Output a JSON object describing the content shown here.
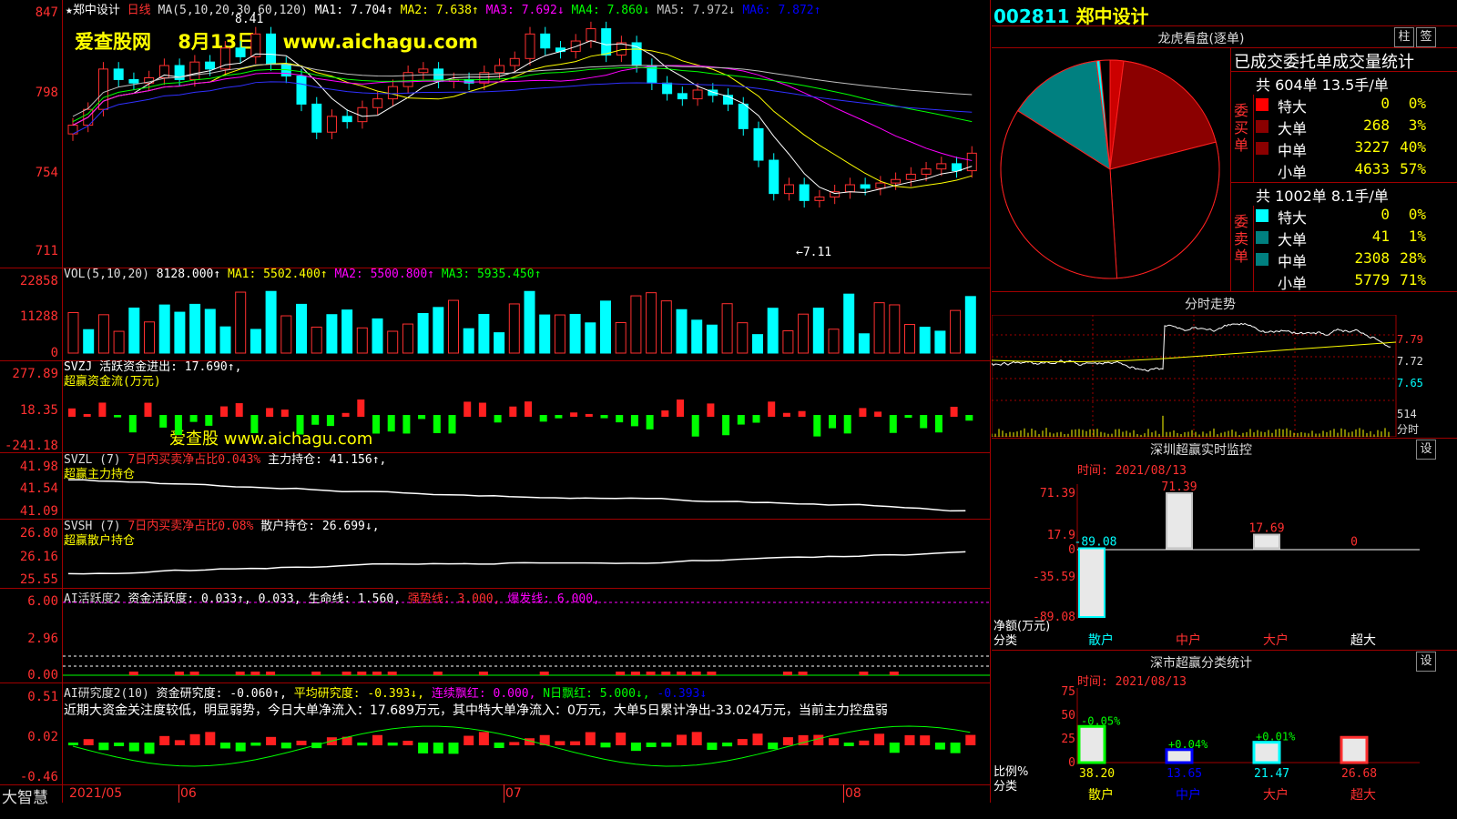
{
  "stock": {
    "code": "002811",
    "name": "郑中设计",
    "period": "日线"
  },
  "watermark": {
    "site": "爱查股网",
    "date": "8月13日",
    "url": "www.aichagu.com",
    "mid": "爱查股 www.aichagu.com"
  },
  "price_panel": {
    "header": {
      "ma_def": "MA(5,10,20,30,60,120)",
      "ma1": "MA1: 7.704↑",
      "ma2": "MA2: 7.638↑",
      "ma3": "MA3: 7.692↓",
      "ma4": "MA4: 7.860↓",
      "ma5": "MA5: 7.972↓",
      "ma6": "MA6: 7.872↑"
    },
    "y_labels": [
      "847",
      "798",
      "754",
      "711"
    ],
    "high_label": "8.41",
    "low_label": "←7.11"
  },
  "vol_panel": {
    "header": {
      "name": "VOL(5,10,20)",
      "value": "8128.000↑",
      "ma1": "MA1: 5502.400↑",
      "ma2": "MA2: 5500.800↑",
      "ma3": "MA3: 5935.450↑"
    },
    "y_labels": [
      "22858",
      "11288",
      "0"
    ]
  },
  "svzj_panel": {
    "header": {
      "line1": "SVZJ  活跃资金进出: 17.690↑,",
      "line2": "超赢资金流(万元)"
    },
    "y_labels": [
      "277.89",
      "18.35",
      "-241.18"
    ]
  },
  "svzl_panel": {
    "header": {
      "name": "SVZL (7)",
      "ratio": "7日内买卖净占比0.043%",
      "hold": "主力持仓: 41.156↑,",
      "line2": "超赢主力持仓"
    },
    "y_labels": [
      "41.98",
      "41.54",
      "41.09"
    ]
  },
  "svsh_panel": {
    "header": {
      "name": "SVSH (7)",
      "ratio": "7日内买卖净占比0.08%",
      "hold": "散户持仓: 26.699↓,",
      "line2": "超赢散户持仓"
    },
    "y_labels": [
      "26.80",
      "26.16",
      "25.55"
    ]
  },
  "ai_active_panel": {
    "header": {
      "name": "AI活跃度2",
      "active": "资金活跃度: 0.033↑, 0.033,",
      "life": "生命线: 1.560,",
      "strong": "强势线: 3.000,",
      "burst": "爆发线: 6.000,"
    },
    "y_labels": [
      "6.00",
      "2.96",
      "0.00"
    ]
  },
  "ai_research_panel": {
    "header": {
      "name": "AI研究度2(10)",
      "research": "资金研究度: -0.060↑,",
      "avg": "平均研究度: -0.393↓,",
      "red": "连续飘红: 0.000,",
      "nred": "N日飘红: 5.000↓,",
      "val": "-0.393↓"
    },
    "comment": "近期大资金关注度较低，明显弱势，今日大单净流入：17.689万元，其中特大单净流入：0万元，大单5日累计净出-33.024万元，当前主力控盘弱",
    "y_labels": [
      "0.51",
      "0.02",
      "-0.46"
    ]
  },
  "x_axis": {
    "labels": [
      "2021/05",
      "06",
      "07",
      "08"
    ],
    "brand": "大智慧"
  },
  "right": {
    "lhb_title": "龙虎看盘(逐单)",
    "btn_zhu": "柱",
    "btn_gear": "签",
    "stats_title": "已成交委托单成交量统计",
    "buy": {
      "summary": "共 604单 13.5手/单",
      "side_label": "委买单",
      "rows": [
        {
          "name": "特大",
          "count": "0",
          "pct": "0%"
        },
        {
          "name": "大单",
          "count": "268",
          "pct": "3%"
        },
        {
          "name": "中单",
          "count": "3227",
          "pct": "40%"
        },
        {
          "name": "小单",
          "count": "4633",
          "pct": "57%"
        }
      ]
    },
    "sell": {
      "summary": "共 1002单 8.1手/单",
      "side_label": "委卖单",
      "rows": [
        {
          "name": "特大",
          "count": "0",
          "pct": "0%"
        },
        {
          "name": "大单",
          "count": "41",
          "pct": "1%"
        },
        {
          "name": "中单",
          "count": "2308",
          "pct": "28%"
        },
        {
          "name": "小单",
          "count": "5779",
          "pct": "71%"
        }
      ]
    },
    "pie": {
      "slices": [
        {
          "label": "buy-large",
          "pct": 2
        },
        {
          "label": "buy-mid",
          "pct": 19
        },
        {
          "label": "buy-small",
          "pct": 28
        },
        {
          "label": "sell-small",
          "pct": 35
        },
        {
          "label": "sell-mid",
          "pct": 14
        },
        {
          "label": "sell-large",
          "pct": 0.5
        }
      ],
      "colors": [
        "#cc0000",
        "#8b0000",
        "#000000",
        "#000000",
        "#008080",
        "#00ffff"
      ]
    },
    "intraday": {
      "title": "分时走势",
      "y_labels": [
        "7.79",
        "7.72",
        "7.65"
      ],
      "vol_label": "514",
      "vol_unit": "分时"
    },
    "monitor": {
      "title": "深圳超赢实时监控",
      "btn": "设",
      "time": "时间: 2021/08/13",
      "y_labels": [
        "71.39",
        "17.9",
        "0",
        "-35.59",
        "-89.08"
      ],
      "unit_label": "净额(万元)",
      "cat_label": "分类",
      "cats": [
        "散户",
        "中户",
        "大户",
        "超大"
      ],
      "chart_data": {
        "type": "bar",
        "categories": [
          "散户",
          "中户",
          "大户",
          "超大"
        ],
        "values": [
          -89.08,
          71.39,
          17.69,
          0
        ],
        "value_labels": [
          "-89.08",
          "71.39",
          "17.69",
          "0"
        ],
        "ylim": [
          -89.08,
          71.39
        ]
      }
    },
    "classify": {
      "title": "深市超赢分类统计",
      "btn": "设",
      "time": "时间: 2021/08/13",
      "y_labels": [
        "75",
        "50",
        "25",
        "0"
      ],
      "unit_label": "比例%",
      "cat_label": "分类",
      "cats": [
        "散户",
        "中户",
        "大户",
        "超大"
      ],
      "chart_data": {
        "type": "bar",
        "categories": [
          "散户",
          "中户",
          "大户",
          "超大"
        ],
        "values": [
          38.2,
          13.65,
          21.47,
          26.68
        ],
        "value_labels": [
          "38.20",
          "13.65",
          "21.47",
          "26.68"
        ],
        "change_labels": [
          "-0.05%",
          "+0.04%",
          "+0.01%",
          ""
        ],
        "ylim": [
          0,
          75
        ]
      }
    }
  }
}
